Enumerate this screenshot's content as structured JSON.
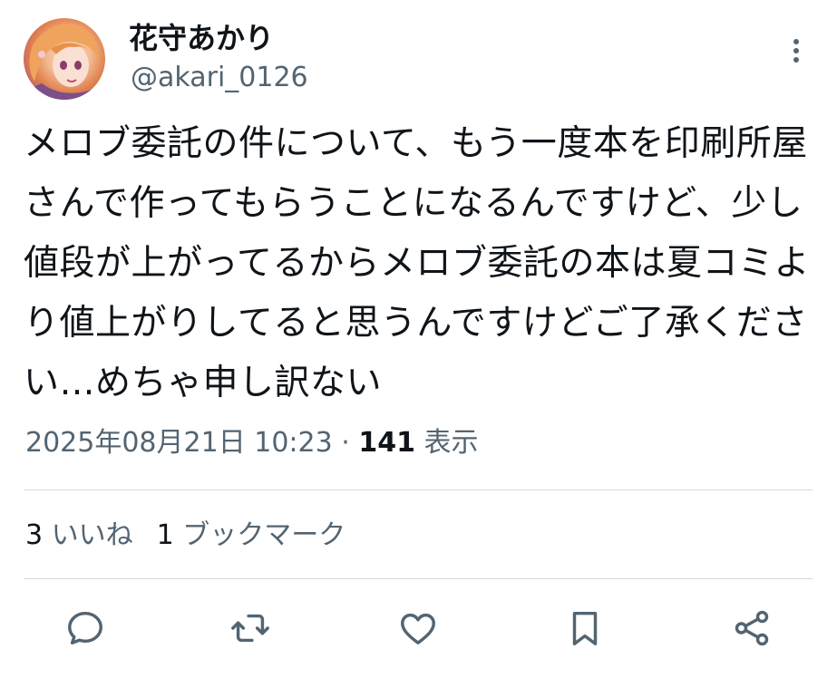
{
  "author": {
    "display_name": "花守あかり",
    "handle": "@akari_0126",
    "avatar_icon": "avatar-illustration"
  },
  "tweet": {
    "text": "メロブ委託の件について、もう一度本を印刷所屋さんで作ってもらうことになるんですけど、少し値段が上がってるからメロブ委託の本は夏コミより値上がりしてると思うんですけどご了承ください…めちゃ申し訳ない"
  },
  "meta": {
    "timestamp": "2025年08月21日 10:23",
    "separator": "·",
    "views_count": "141",
    "views_label": "表示"
  },
  "stats": {
    "likes_count": "3",
    "likes_label": "いいね",
    "bookmarks_count": "1",
    "bookmarks_label": "ブックマーク"
  },
  "actions": [
    {
      "name": "reply",
      "icon": "reply-icon"
    },
    {
      "name": "retweet",
      "icon": "retweet-icon"
    },
    {
      "name": "like",
      "icon": "heart-icon"
    },
    {
      "name": "bookmark",
      "icon": "bookmark-icon"
    },
    {
      "name": "share",
      "icon": "share-icon"
    }
  ],
  "colors": {
    "text_primary": "#0f1419",
    "text_secondary": "#536471",
    "divider": "#cfd9de",
    "icon": "#536471"
  }
}
